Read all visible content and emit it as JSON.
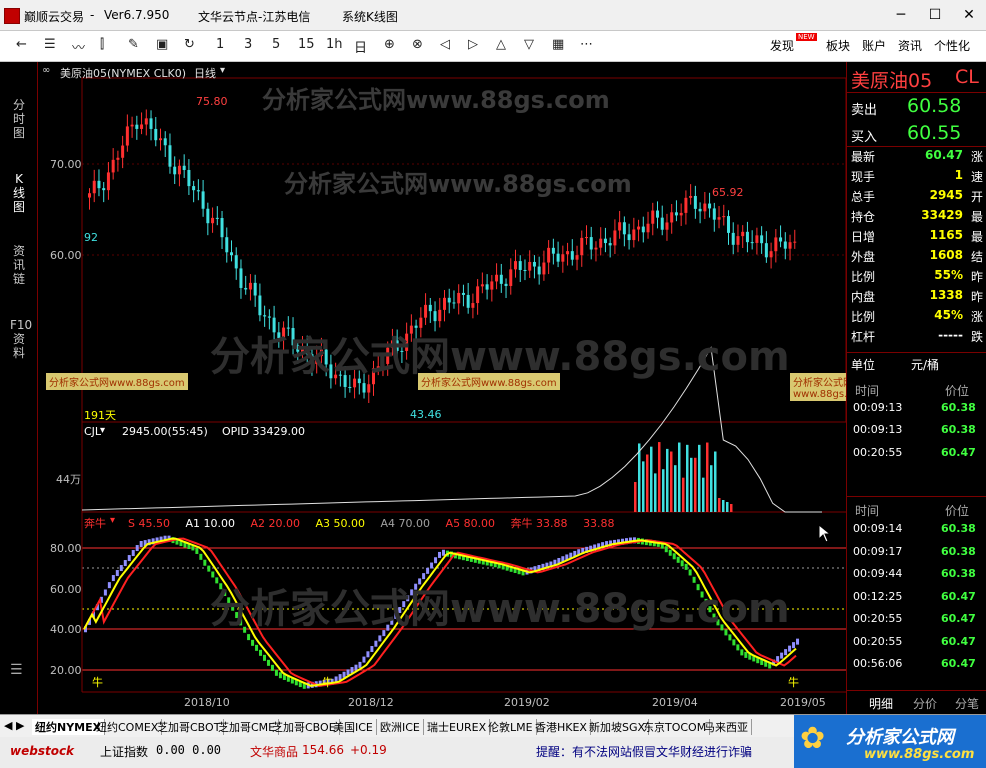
{
  "title_bar": {
    "app_name": "巅顺云交易",
    "version": "Ver6.7.950",
    "node": "文华云节点-江苏电信",
    "mode": "系统K线图"
  },
  "toolbar": {
    "periods": [
      "1",
      "3",
      "5",
      "15",
      "1h",
      "日"
    ],
    "right_items": [
      "发现",
      "板块",
      "账户",
      "资讯",
      "个性化"
    ],
    "new_badge": "NEW"
  },
  "left_nav": {
    "tabs": [
      "分时图",
      "K线图",
      "资讯链",
      "F10资料"
    ]
  },
  "chart_header": {
    "contract": "美原油05(NYMEX CLK0)",
    "period": "日线"
  },
  "watermarks": {
    "text_cn": "分析家公式网",
    "text_url": "www.88gs.com",
    "small_tag": "分析家公式网www.88gs.com"
  },
  "main_chart": {
    "y_ticks": [
      "70.00",
      "60.00"
    ],
    "high_label": "75.80",
    "low_label": "43.46",
    "recent_high_label": "65.92",
    "left_edge_label": "92",
    "days_label": "191天"
  },
  "volume_panel": {
    "header": "CJL",
    "value_label": "2945.00(55:45)",
    "opi_label": "OPID 33429.00",
    "y_label": "44万"
  },
  "indicator_panel": {
    "name": "奔牛",
    "params": [
      {
        "label": "S 45.50",
        "color": "#ff3030"
      },
      {
        "label": "A1 10.00",
        "color": "#ffffff"
      },
      {
        "label": "A2 20.00",
        "color": "#ff3030"
      },
      {
        "label": "A3 50.00",
        "color": "#ffff00"
      },
      {
        "label": "A4 70.00",
        "color": "#a0a0a0"
      },
      {
        "label": "A5 80.00",
        "color": "#ff3030"
      },
      {
        "label": "奔牛 33.88",
        "color": "#ff3030"
      },
      {
        "label": "33.88",
        "color": "#ff3030"
      }
    ],
    "y_ticks": [
      "80.00",
      "60.00",
      "40.00",
      "20.00"
    ],
    "bull_markers": [
      "牛",
      "牛",
      "牛"
    ]
  },
  "x_axis": [
    "2018/10",
    "2018/12",
    "2019/02",
    "2019/04",
    "2019/05"
  ],
  "quote_panel": {
    "name": "美原油05",
    "code": "CL",
    "sell_label": "卖出",
    "sell_price": "60.58",
    "buy_label": "买入",
    "buy_price": "60.55",
    "rows": [
      {
        "k": "最新",
        "v": "60.47",
        "x": "涨"
      },
      {
        "k": "现手",
        "v": "1",
        "x": "速"
      },
      {
        "k": "总手",
        "v": "2945",
        "x": "开"
      },
      {
        "k": "持仓",
        "v": "33429",
        "x": "最"
      },
      {
        "k": "日增",
        "v": "1165",
        "x": "最"
      },
      {
        "k": "外盘",
        "v": "1608",
        "x": "结"
      },
      {
        "k": "比例",
        "v": "55%",
        "x": "昨"
      },
      {
        "k": "内盘",
        "v": "1338",
        "x": "昨"
      },
      {
        "k": "比例",
        "v": "45%",
        "x": "涨"
      },
      {
        "k": "杠杆",
        "v": "-----",
        "x": "跌"
      }
    ],
    "unit_label": "单位",
    "unit_value": "元/桶",
    "table_headers": [
      "时间",
      "价位"
    ],
    "ticks_top": [
      {
        "t": "00:09:13",
        "p": "60.38"
      },
      {
        "t": "00:09:13",
        "p": "60.38"
      },
      {
        "t": "00:20:55",
        "p": "60.47"
      }
    ],
    "ticks_bottom": [
      {
        "t": "00:09:14",
        "p": "60.38"
      },
      {
        "t": "00:09:17",
        "p": "60.38"
      },
      {
        "t": "00:09:44",
        "p": "60.38"
      },
      {
        "t": "00:12:25",
        "p": "60.47"
      },
      {
        "t": "00:20:55",
        "p": "60.47"
      },
      {
        "t": "00:20:55",
        "p": "60.47"
      },
      {
        "t": "00:56:06",
        "p": "60.47"
      }
    ],
    "bottom_tabs": [
      "明细",
      "分价",
      "分笔"
    ]
  },
  "exchange_tabs": [
    "纽约NYMEX",
    "纽约COMEX",
    "芝加哥CBOT",
    "芝加哥CME",
    "芝加哥CBOE",
    "美国ICE",
    "欧洲ICE",
    "瑞士EUREX",
    "伦敦LME",
    "香港HKEX",
    "新加坡SGX",
    "东京TOCOM",
    "马来西亚"
  ],
  "status_bar": {
    "brand": "webstock",
    "index_label": "上证指数",
    "index_values": "0.00  0.00",
    "commodity_label": "文华商品",
    "commodity_value": "154.66",
    "commodity_change": "+0.19",
    "notice": "提醒：有不法网站假冒文华财经进行诈骗",
    "banner_title": "分析家公式网",
    "banner_url": "www.88gs.com"
  },
  "colors": {
    "up": "#ff3030",
    "down": "#40e0e0",
    "accent_yellow": "#ffff00",
    "grid_red": "#7a0000"
  },
  "chart_data": {
    "type": "candlestick",
    "x": [
      "2018/10",
      "2018/12",
      "2019/02",
      "2019/04",
      "2019/05"
    ],
    "close": [
      66,
      70,
      75.8,
      72,
      68,
      64,
      58,
      53,
      50,
      48,
      46,
      43.46,
      47,
      50,
      53,
      54,
      55,
      57,
      58,
      59,
      60,
      61,
      62,
      63,
      64,
      65.92,
      63,
      61,
      60.5,
      60.47
    ],
    "indicator": [
      40,
      65,
      82,
      85,
      80,
      60,
      35,
      18,
      12,
      14,
      22,
      40,
      60,
      78,
      75,
      72,
      68,
      72,
      78,
      82,
      84,
      82,
      70,
      45,
      28,
      22,
      33.88
    ],
    "volume_max_label": "44万"
  }
}
